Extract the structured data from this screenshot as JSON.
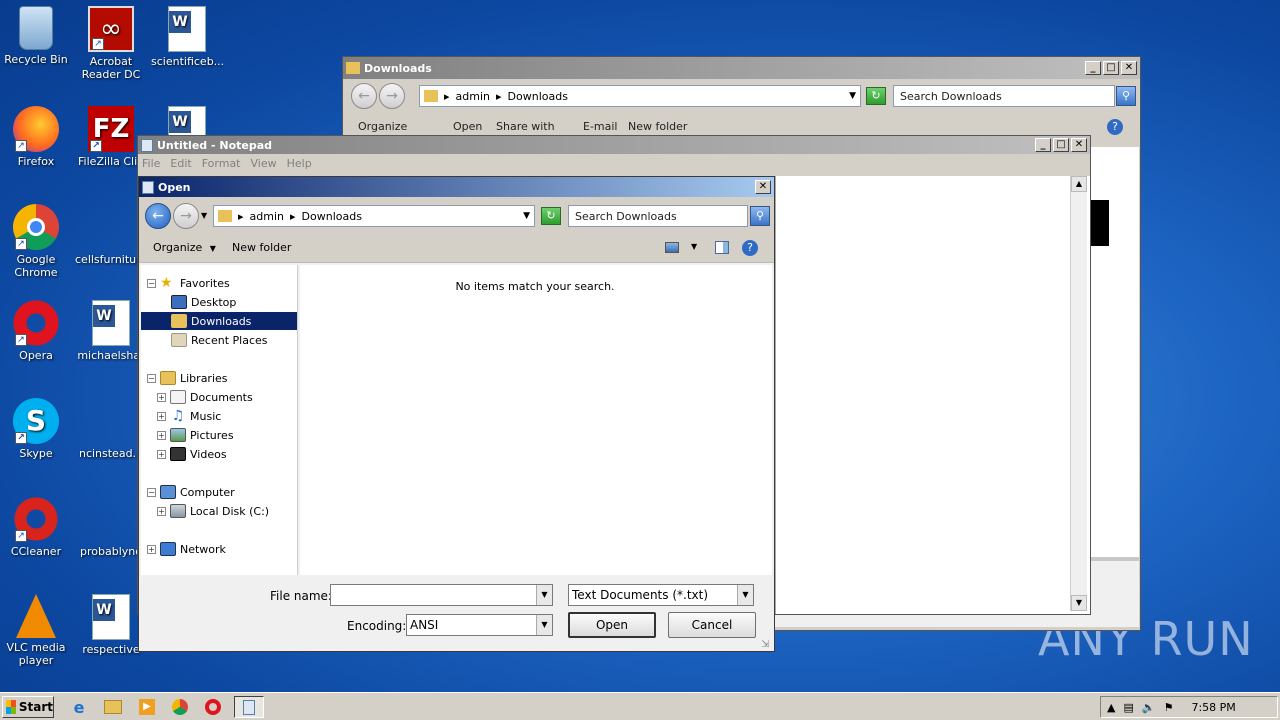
{
  "desktop": {
    "icons": [
      {
        "label": "Recycle Bin"
      },
      {
        "label": "Acrobat Reader DC"
      },
      {
        "label": "scientificeb..."
      },
      {
        "label": "Firefox"
      },
      {
        "label": "FileZilla Clie"
      },
      {
        "label": "Google Chrome"
      },
      {
        "label": "cellsfurniture"
      },
      {
        "label": "Opera"
      },
      {
        "label": "michaelshar"
      },
      {
        "label": "Skype"
      },
      {
        "label": "ncinstead.p"
      },
      {
        "label": "CCleaner"
      },
      {
        "label": "probablyno"
      },
      {
        "label": "VLC media player"
      },
      {
        "label": "respective"
      }
    ],
    "watermark": "ANY RUN"
  },
  "explorer": {
    "title": "Downloads",
    "breadcrumb": [
      "admin",
      "Downloads"
    ],
    "search_placeholder": "Search Downloads",
    "toolbar": [
      "Organize",
      "Open",
      "Share with",
      "E-mail",
      "New folder"
    ]
  },
  "notepad": {
    "title": "Untitled - Notepad",
    "menu": [
      "File",
      "Edit",
      "Format",
      "View",
      "Help"
    ]
  },
  "open_dialog": {
    "title": "Open",
    "breadcrumb": [
      "admin",
      "Downloads"
    ],
    "search_placeholder": "Search Downloads",
    "toolbar": {
      "organize": "Organize",
      "new_folder": "New folder"
    },
    "empty_message": "No items match your search.",
    "tree": {
      "favorites": "Favorites",
      "desktop": "Desktop",
      "downloads": "Downloads",
      "recent": "Recent Places",
      "libraries": "Libraries",
      "documents": "Documents",
      "music": "Music",
      "pictures": "Pictures",
      "videos": "Videos",
      "computer": "Computer",
      "local_disk": "Local Disk (C:)",
      "network": "Network"
    },
    "file_name_label": "File name:",
    "file_name_value": "",
    "file_type": "Text Documents (*.txt)",
    "encoding_label": "Encoding:",
    "encoding_value": "ANSI",
    "open_button": "Open",
    "cancel_button": "Cancel"
  },
  "taskbar": {
    "start": "Start",
    "clock": "7:58 PM"
  }
}
